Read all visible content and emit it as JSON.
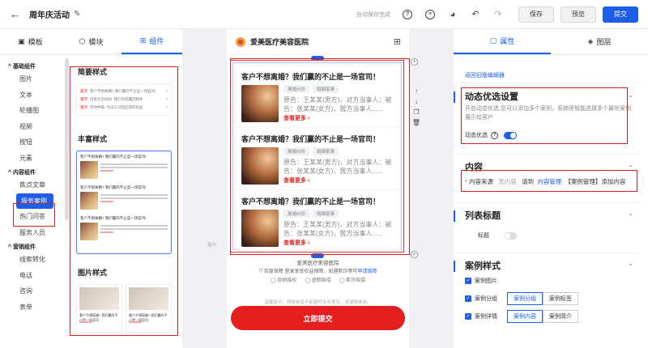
{
  "topbar": {
    "back_icon": "←",
    "title": "周年庆活动",
    "edit_icon": "✎",
    "autosave": "自动保存完成",
    "help_icon": "?",
    "stop_icon": "≡",
    "palette_icon": "◕",
    "undo_icon": "↶",
    "redo_icon": "↷",
    "save_label": "保存",
    "preview_label": "预览",
    "submit_label": "提交"
  },
  "left": {
    "tabs": [
      {
        "icon": "▣",
        "label": "模板"
      },
      {
        "icon": "⬡",
        "label": "模块"
      },
      {
        "icon": "⊞",
        "label": "组件"
      }
    ],
    "groups": [
      {
        "label": "基础组件",
        "items": [
          "图片",
          "文本",
          "轮播图",
          "视频",
          "按钮",
          "元素"
        ]
      },
      {
        "label": "内容组件",
        "items": [
          "焦点文章",
          "服务案例",
          "热门问答",
          "服务人员"
        ]
      },
      {
        "label": "营销组件",
        "items": [
          "线索转化",
          "电话",
          "咨询",
          "表单"
        ]
      }
    ],
    "active_item": "服务案例",
    "sections": {
      "simple": "简要样式",
      "rich": "丰富样式",
      "picture": "图片样式"
    },
    "simple_rows": [
      {
        "tag": "置顶",
        "text": "客户不想离婚? 我们赢的不止是一场官司!"
      },
      {
        "tag": "置顶",
        "text": "房屋买卖纠纷, 我们为您赢回损失"
      },
      {
        "tag": "置顶",
        "text": "劳动仲裁, 为员工讨回应得的权益"
      }
    ],
    "rich_head": "客户不想离婚? 我们赢的不止是一场官司!",
    "picture_head": "客户不想离婚? 我们赢的不止是一场官司"
  },
  "phone": {
    "brand": "爱美医疗美容医院",
    "grid_icon": "⊞",
    "cases": [
      {
        "title": "客户不想离婚？我们赢的不止是一场官司！",
        "chips": [
          "离婚纠纷",
          "婚姻家事"
        ],
        "desc": "原告：王某某(男方)，对方当事人：被告：张某某(女方)，我方当事人......",
        "more": "查看更多 ›"
      },
      {
        "title": "客户不想离婚？我们赢的不止是一场官司！",
        "chips": [
          "离婚纠纷",
          "婚姻家事"
        ],
        "desc": "原告：王某某(男方)，对方当事人：被告：张某某(女方)，我方当事人......",
        "more": "查看更多 ›"
      },
      {
        "title": "客户不想离婚？我们赢的不止是一场官司！",
        "chips": [
          "离婚纠纷",
          "婚姻家事"
        ],
        "desc": "原告：王某某(男方)，对方当事人：被告：张某某(女方)，我方当事人......",
        "more": "查看更多 ›"
      }
    ],
    "side_label": "留白",
    "footer_brand": "爱美医疗美容医院",
    "footer_note": "百度保障 登录享受权益保障，如遇欺诈等可",
    "footer_link": "申请保障",
    "footer_opts": [
      "协助维权",
      "虚假赔偿",
      "欺诈赔偿"
    ],
    "footer_notice": "温馨提示：网络信息不能替代专业意见，请谨慎参阅。",
    "submit_label": "立即提交"
  },
  "right": {
    "tabs": [
      {
        "icon": "▢",
        "label": "属性"
      },
      {
        "icon": "◈",
        "label": "图层"
      }
    ],
    "back_link": "返回旧版编辑器",
    "dyn_title": "动态优选设置",
    "dyn_desc": "开启动态优选,您可以添加多个案例，系统将智能选择多个最优案例展示给客户",
    "dyn_toggle_label": "动态优选",
    "dyn_help": "?",
    "content_title": "内容",
    "content_req": "*",
    "content_source": "内容来源",
    "content_empty": "无内容",
    "content_go": "请到",
    "content_link": "内容管理",
    "content_tail": "【案例管理】添加内容",
    "list_title": "列表标题",
    "list_title_label": "标题",
    "case_style_title": "案例样式",
    "case_image_label": "案例图片",
    "case_group_label": "案例分组",
    "case_group_opts": [
      "案例分组",
      "案例标签"
    ],
    "case_detail_label": "案例详情",
    "case_detail_opts": [
      "案例内容",
      "案例简介"
    ]
  },
  "colors": {
    "accent": "#1d5ee6",
    "annotation": "#d52020",
    "submit": "#e41e1e"
  }
}
